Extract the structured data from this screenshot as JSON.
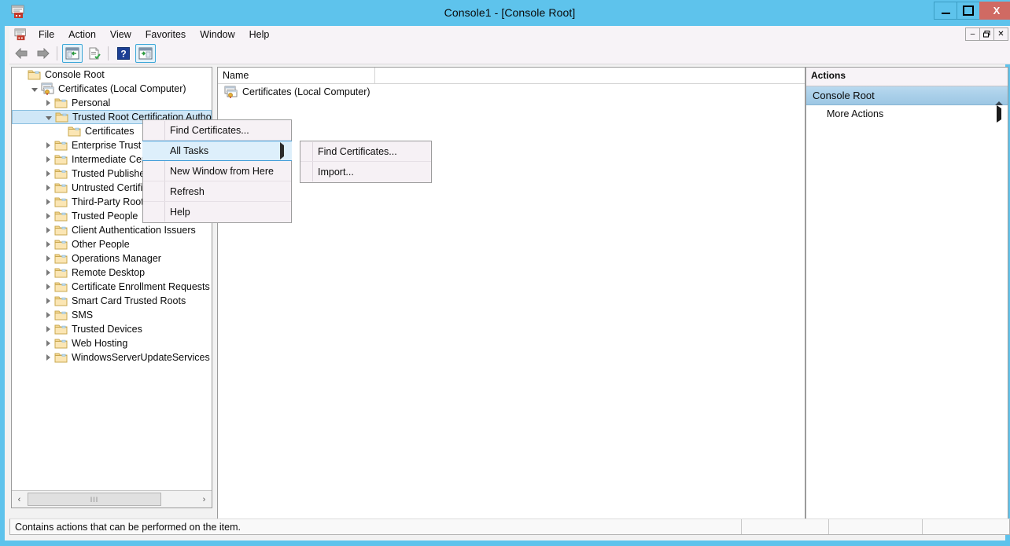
{
  "window": {
    "title": "Console1 - [Console Root]",
    "title_icon": "mmc-console-icon",
    "buttons": {
      "minimize": "minimize-icon",
      "maximize": "maximize-icon",
      "close": "X"
    },
    "mdi_buttons": {
      "minimize": "–",
      "restore": "restore-icon",
      "close": "✕"
    }
  },
  "menubar": {
    "items": [
      {
        "label": "File"
      },
      {
        "label": "Action"
      },
      {
        "label": "View"
      },
      {
        "label": "Favorites"
      },
      {
        "label": "Window"
      },
      {
        "label": "Help"
      }
    ]
  },
  "toolbar": {
    "items": [
      {
        "name": "back-arrow-icon"
      },
      {
        "name": "forward-arrow-icon"
      },
      {
        "name": "show-hide-tree-icon"
      },
      {
        "name": "export-list-icon"
      },
      {
        "name": "help-icon"
      },
      {
        "name": "show-hide-action-pane-icon"
      }
    ]
  },
  "tree": {
    "nodes": [
      {
        "label": "Console Root",
        "indent": 0,
        "expander": "none",
        "icon": "folder-icon",
        "selected": false
      },
      {
        "label": "Certificates (Local Computer)",
        "indent": 1,
        "expander": "expanded",
        "icon": "certificates-icon",
        "selected": false
      },
      {
        "label": "Personal",
        "indent": 2,
        "expander": "collapsed",
        "icon": "folder-icon",
        "selected": false
      },
      {
        "label": "Trusted Root Certification Authorities",
        "indent": 2,
        "expander": "expanded",
        "icon": "folder-icon",
        "selected": true
      },
      {
        "label": "Certificates",
        "indent": 3,
        "expander": "none",
        "icon": "folder-icon",
        "selected": false
      },
      {
        "label": "Enterprise Trust",
        "indent": 2,
        "expander": "collapsed",
        "icon": "folder-icon",
        "selected": false
      },
      {
        "label": "Intermediate Certification Authorities",
        "indent": 2,
        "expander": "collapsed",
        "icon": "folder-icon",
        "selected": false
      },
      {
        "label": "Trusted Publishers",
        "indent": 2,
        "expander": "collapsed",
        "icon": "folder-icon",
        "selected": false
      },
      {
        "label": "Untrusted Certificates",
        "indent": 2,
        "expander": "collapsed",
        "icon": "folder-icon",
        "selected": false
      },
      {
        "label": "Third-Party Root Certification Authorities",
        "indent": 2,
        "expander": "collapsed",
        "icon": "folder-icon",
        "selected": false
      },
      {
        "label": "Trusted People",
        "indent": 2,
        "expander": "collapsed",
        "icon": "folder-icon",
        "selected": false
      },
      {
        "label": "Client Authentication Issuers",
        "indent": 2,
        "expander": "collapsed",
        "icon": "folder-icon",
        "selected": false
      },
      {
        "label": "Other People",
        "indent": 2,
        "expander": "collapsed",
        "icon": "folder-icon",
        "selected": false
      },
      {
        "label": "Operations Manager",
        "indent": 2,
        "expander": "collapsed",
        "icon": "folder-icon",
        "selected": false
      },
      {
        "label": "Remote Desktop",
        "indent": 2,
        "expander": "collapsed",
        "icon": "folder-icon",
        "selected": false
      },
      {
        "label": "Certificate Enrollment Requests",
        "indent": 2,
        "expander": "collapsed",
        "icon": "folder-icon",
        "selected": false
      },
      {
        "label": "Smart Card Trusted Roots",
        "indent": 2,
        "expander": "collapsed",
        "icon": "folder-icon",
        "selected": false
      },
      {
        "label": "SMS",
        "indent": 2,
        "expander": "collapsed",
        "icon": "folder-icon",
        "selected": false
      },
      {
        "label": "Trusted Devices",
        "indent": 2,
        "expander": "collapsed",
        "icon": "folder-icon",
        "selected": false
      },
      {
        "label": "Web Hosting",
        "indent": 2,
        "expander": "collapsed",
        "icon": "folder-icon",
        "selected": false
      },
      {
        "label": "WindowsServerUpdateServices",
        "indent": 2,
        "expander": "collapsed",
        "icon": "folder-icon",
        "selected": false
      }
    ],
    "scrollbar": {
      "left_arrow": "‹",
      "right_arrow": "›",
      "thumb_glyph": "III"
    }
  },
  "list_pane": {
    "columns": [
      {
        "label": "Name"
      }
    ],
    "rows": [
      {
        "name": "Certificates (Local Computer)",
        "icon": "certificates-icon"
      }
    ]
  },
  "actions_pane": {
    "header": "Actions",
    "group": {
      "label": "Console Root",
      "collapse_icon": "chevron-up-icon"
    },
    "items": [
      {
        "label": "More Actions",
        "submenu_icon": "chevron-right-icon"
      }
    ]
  },
  "context_menu": {
    "items": [
      {
        "label": "Find Certificates...",
        "highlighted": false,
        "has_submenu": false
      },
      {
        "label": "All Tasks",
        "highlighted": true,
        "has_submenu": true
      },
      {
        "label": "New Window from Here",
        "highlighted": false,
        "has_submenu": false
      },
      {
        "label": "Refresh",
        "highlighted": false,
        "has_submenu": false
      },
      {
        "label": "Help",
        "highlighted": false,
        "has_submenu": false
      }
    ],
    "submenu": {
      "items": [
        {
          "label": "Find Certificates..."
        },
        {
          "label": "Import..."
        }
      ]
    }
  },
  "statusbar": {
    "message": "Contains actions that can be performed on the item."
  },
  "colors": {
    "titlebar": "#5ec3ec",
    "close_button": "#d06a63",
    "selection": "#cfe7f7",
    "menu_highlight": "#ddeffb",
    "menu_highlight_border": "#3c9ad6",
    "action_group": "#a9cfe9",
    "folder": "#f5d896"
  }
}
